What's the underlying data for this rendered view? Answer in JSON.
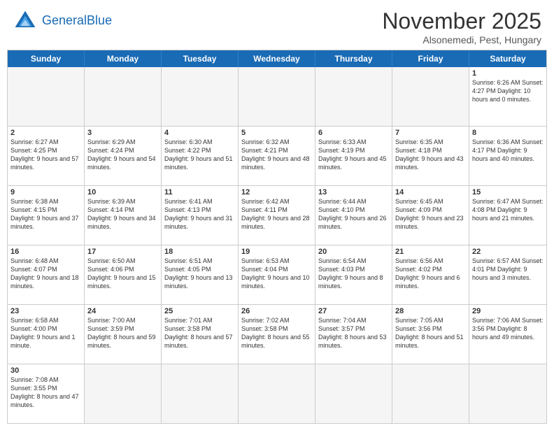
{
  "logo": {
    "text_general": "General",
    "text_blue": "Blue"
  },
  "header": {
    "month": "November 2025",
    "location": "Alsonemedi, Pest, Hungary"
  },
  "day_headers": [
    "Sunday",
    "Monday",
    "Tuesday",
    "Wednesday",
    "Thursday",
    "Friday",
    "Saturday"
  ],
  "weeks": [
    [
      {
        "num": "",
        "info": "",
        "empty": true
      },
      {
        "num": "",
        "info": "",
        "empty": true
      },
      {
        "num": "",
        "info": "",
        "empty": true
      },
      {
        "num": "",
        "info": "",
        "empty": true
      },
      {
        "num": "",
        "info": "",
        "empty": true
      },
      {
        "num": "",
        "info": "",
        "empty": true
      },
      {
        "num": "1",
        "info": "Sunrise: 6:26 AM\nSunset: 4:27 PM\nDaylight: 10 hours\nand 0 minutes.",
        "empty": false
      }
    ],
    [
      {
        "num": "2",
        "info": "Sunrise: 6:27 AM\nSunset: 4:25 PM\nDaylight: 9 hours\nand 57 minutes.",
        "empty": false
      },
      {
        "num": "3",
        "info": "Sunrise: 6:29 AM\nSunset: 4:24 PM\nDaylight: 9 hours\nand 54 minutes.",
        "empty": false
      },
      {
        "num": "4",
        "info": "Sunrise: 6:30 AM\nSunset: 4:22 PM\nDaylight: 9 hours\nand 51 minutes.",
        "empty": false
      },
      {
        "num": "5",
        "info": "Sunrise: 6:32 AM\nSunset: 4:21 PM\nDaylight: 9 hours\nand 48 minutes.",
        "empty": false
      },
      {
        "num": "6",
        "info": "Sunrise: 6:33 AM\nSunset: 4:19 PM\nDaylight: 9 hours\nand 45 minutes.",
        "empty": false
      },
      {
        "num": "7",
        "info": "Sunrise: 6:35 AM\nSunset: 4:18 PM\nDaylight: 9 hours\nand 43 minutes.",
        "empty": false
      },
      {
        "num": "8",
        "info": "Sunrise: 6:36 AM\nSunset: 4:17 PM\nDaylight: 9 hours\nand 40 minutes.",
        "empty": false
      }
    ],
    [
      {
        "num": "9",
        "info": "Sunrise: 6:38 AM\nSunset: 4:15 PM\nDaylight: 9 hours\nand 37 minutes.",
        "empty": false
      },
      {
        "num": "10",
        "info": "Sunrise: 6:39 AM\nSunset: 4:14 PM\nDaylight: 9 hours\nand 34 minutes.",
        "empty": false
      },
      {
        "num": "11",
        "info": "Sunrise: 6:41 AM\nSunset: 4:13 PM\nDaylight: 9 hours\nand 31 minutes.",
        "empty": false
      },
      {
        "num": "12",
        "info": "Sunrise: 6:42 AM\nSunset: 4:11 PM\nDaylight: 9 hours\nand 28 minutes.",
        "empty": false
      },
      {
        "num": "13",
        "info": "Sunrise: 6:44 AM\nSunset: 4:10 PM\nDaylight: 9 hours\nand 26 minutes.",
        "empty": false
      },
      {
        "num": "14",
        "info": "Sunrise: 6:45 AM\nSunset: 4:09 PM\nDaylight: 9 hours\nand 23 minutes.",
        "empty": false
      },
      {
        "num": "15",
        "info": "Sunrise: 6:47 AM\nSunset: 4:08 PM\nDaylight: 9 hours\nand 21 minutes.",
        "empty": false
      }
    ],
    [
      {
        "num": "16",
        "info": "Sunrise: 6:48 AM\nSunset: 4:07 PM\nDaylight: 9 hours\nand 18 minutes.",
        "empty": false
      },
      {
        "num": "17",
        "info": "Sunrise: 6:50 AM\nSunset: 4:06 PM\nDaylight: 9 hours\nand 15 minutes.",
        "empty": false
      },
      {
        "num": "18",
        "info": "Sunrise: 6:51 AM\nSunset: 4:05 PM\nDaylight: 9 hours\nand 13 minutes.",
        "empty": false
      },
      {
        "num": "19",
        "info": "Sunrise: 6:53 AM\nSunset: 4:04 PM\nDaylight: 9 hours\nand 10 minutes.",
        "empty": false
      },
      {
        "num": "20",
        "info": "Sunrise: 6:54 AM\nSunset: 4:03 PM\nDaylight: 9 hours\nand 8 minutes.",
        "empty": false
      },
      {
        "num": "21",
        "info": "Sunrise: 6:56 AM\nSunset: 4:02 PM\nDaylight: 9 hours\nand 6 minutes.",
        "empty": false
      },
      {
        "num": "22",
        "info": "Sunrise: 6:57 AM\nSunset: 4:01 PM\nDaylight: 9 hours\nand 3 minutes.",
        "empty": false
      }
    ],
    [
      {
        "num": "23",
        "info": "Sunrise: 6:58 AM\nSunset: 4:00 PM\nDaylight: 9 hours\nand 1 minute.",
        "empty": false
      },
      {
        "num": "24",
        "info": "Sunrise: 7:00 AM\nSunset: 3:59 PM\nDaylight: 8 hours\nand 59 minutes.",
        "empty": false
      },
      {
        "num": "25",
        "info": "Sunrise: 7:01 AM\nSunset: 3:58 PM\nDaylight: 8 hours\nand 57 minutes.",
        "empty": false
      },
      {
        "num": "26",
        "info": "Sunrise: 7:02 AM\nSunset: 3:58 PM\nDaylight: 8 hours\nand 55 minutes.",
        "empty": false
      },
      {
        "num": "27",
        "info": "Sunrise: 7:04 AM\nSunset: 3:57 PM\nDaylight: 8 hours\nand 53 minutes.",
        "empty": false
      },
      {
        "num": "28",
        "info": "Sunrise: 7:05 AM\nSunset: 3:56 PM\nDaylight: 8 hours\nand 51 minutes.",
        "empty": false
      },
      {
        "num": "29",
        "info": "Sunrise: 7:06 AM\nSunset: 3:56 PM\nDaylight: 8 hours\nand 49 minutes.",
        "empty": false
      }
    ],
    [
      {
        "num": "30",
        "info": "Sunrise: 7:08 AM\nSunset: 3:55 PM\nDaylight: 8 hours\nand 47 minutes.",
        "empty": false
      },
      {
        "num": "",
        "info": "",
        "empty": true
      },
      {
        "num": "",
        "info": "",
        "empty": true
      },
      {
        "num": "",
        "info": "",
        "empty": true
      },
      {
        "num": "",
        "info": "",
        "empty": true
      },
      {
        "num": "",
        "info": "",
        "empty": true
      },
      {
        "num": "",
        "info": "",
        "empty": true
      }
    ]
  ]
}
